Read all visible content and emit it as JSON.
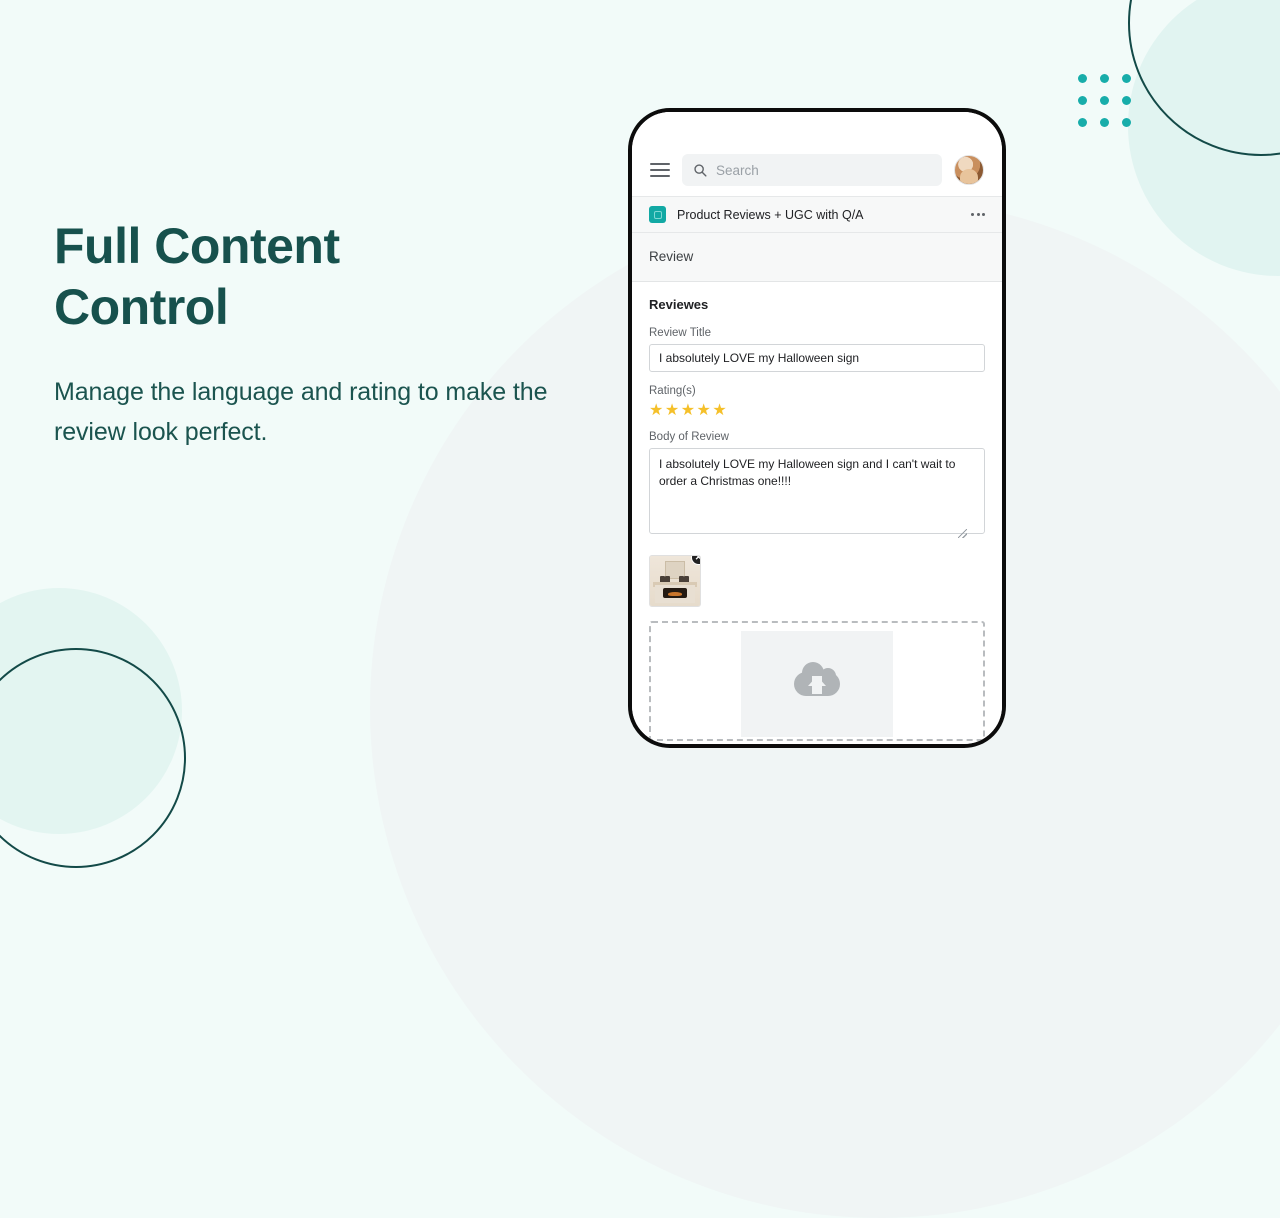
{
  "hero": {
    "title_line1": "Full Content",
    "title_line2": "Control",
    "subtitle": "Manage the language and rating to make the review look perfect.",
    "title_color": "#17514d",
    "background_color": "#f2fbf9",
    "accent_color": "#18adaa"
  },
  "phone": {
    "topbar": {
      "menu_icon": "hamburger-icon",
      "search_placeholder": "Search",
      "search_value": "",
      "search_icon": "search-icon",
      "avatar": "user-avatar"
    },
    "app_row": {
      "app_icon": "app-icon",
      "app_name": "Product Reviews + UGC with Q/A",
      "overflow_icon": "more-options-icon"
    },
    "review_header": {
      "label": "Review"
    },
    "form": {
      "section_title": "Reviewes",
      "title_field": {
        "label": "Review Title",
        "value": "I absolutely LOVE my Halloween sign"
      },
      "rating_field": {
        "label": "Rating(s)",
        "stars": "★★★★★",
        "value": 5,
        "max": 5,
        "star_color": "#f5c02a"
      },
      "body_field": {
        "label": "Body of Review",
        "value": "I absolutely LOVE my Halloween sign and I can't wait to order a Christmas one!!!!"
      },
      "media": {
        "thumbnail_alt": "fireplace-mantel-photo",
        "remove_label": "✕"
      },
      "dropzone": {
        "upload_icon": "cloud-upload-icon",
        "hint": ""
      }
    }
  },
  "decor": {
    "dot_grid_count": 9,
    "dot_color": "#18adaa",
    "ring_color": "#134a48",
    "mint_color": "#e1f4f1"
  }
}
